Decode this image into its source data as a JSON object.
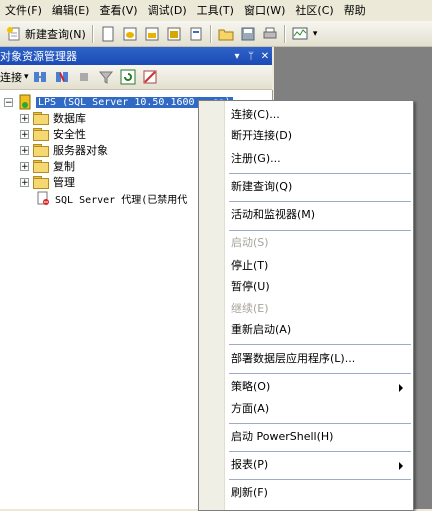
{
  "menubar": [
    "文件(F)",
    "编辑(E)",
    "查看(V)",
    "调试(D)",
    "工具(T)",
    "窗口(W)",
    "社区(C)",
    "帮助"
  ],
  "toolbar": {
    "new_query": "新建查询(N)"
  },
  "panel": {
    "title": "对象资源管理器",
    "connect": "连接"
  },
  "tree": {
    "root": "LPS (SQL Server 10.50.1600 - sa)",
    "items": [
      "数据库",
      "安全性",
      "服务器对象",
      "复制",
      "管理"
    ],
    "agent": "SQL Server 代理(已禁用代"
  },
  "context_menu": {
    "items": [
      {
        "label": "连接(C)...",
        "enabled": true
      },
      {
        "label": "断开连接(D)",
        "enabled": true
      },
      {
        "label": "注册(G)...",
        "enabled": true
      },
      {
        "label": "新建查询(Q)",
        "enabled": true
      },
      {
        "label": "活动和监视器(M)",
        "enabled": true
      },
      {
        "label": "启动(S)",
        "enabled": false
      },
      {
        "label": "停止(T)",
        "enabled": true
      },
      {
        "label": "暂停(U)",
        "enabled": true
      },
      {
        "label": "继续(E)",
        "enabled": false
      },
      {
        "label": "重新启动(A)",
        "enabled": true
      },
      {
        "label": "部署数据层应用程序(L)...",
        "enabled": true
      },
      {
        "label": "策略(O)",
        "enabled": true
      },
      {
        "label": "方面(A)",
        "enabled": true
      },
      {
        "label": "启动 PowerShell(H)",
        "enabled": true
      },
      {
        "label": "报表(P)",
        "enabled": true
      },
      {
        "label": "刷新(F)",
        "enabled": true
      }
    ]
  }
}
